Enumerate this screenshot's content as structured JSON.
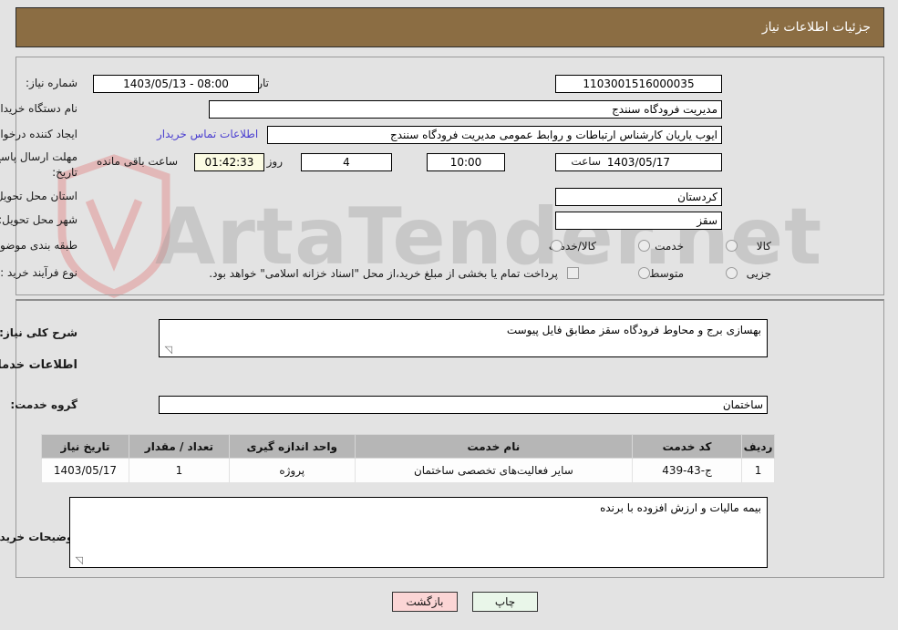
{
  "header": {
    "title": "جزئیات اطلاعات نیاز",
    "bar_color": "#8b6d43"
  },
  "watermark": {
    "text": "ArtaTender.net"
  },
  "top_form": {
    "need_number_label": "شماره نیاز:",
    "need_number_value": "1103001516000035",
    "announce_datetime_label": "تاریخ و ساعت اعلان عمومی:",
    "announce_datetime_value": "08:00 - 1403/05/13",
    "buyer_org_label": "نام دستگاه خریدار:",
    "buyer_org_value": "مدیریت فرودگاه سنندج",
    "creator_label": "ایجاد کننده درخواست:",
    "creator_value": "ایوب یاریان کارشناس ارتباطات و روابط عمومی مدیریت فرودگاه سنندج",
    "contact_link": "اطلاعات تماس خریدار",
    "deadline_label_line1": "مهلت ارسال پاسخ: تا",
    "deadline_label_line2": "تاریخ:",
    "deadline_date": "1403/05/17",
    "deadline_hour_label": "ساعت",
    "deadline_hour_value": "10:00",
    "remaining_days": "4",
    "remaining_days_label": "روز و",
    "remaining_time": "01:42:33",
    "remaining_time_label": "ساعت باقی مانده",
    "province_label": "استان محل تحویل:",
    "province_value": "کردستان",
    "city_label": "شهر محل تحویل:",
    "city_value": "سقز",
    "category_label": "طبقه بندی موضوعی:",
    "category_options": [
      {
        "label": "کالا",
        "selected": false
      },
      {
        "label": "خدمت",
        "selected": false
      },
      {
        "label": "کالا/خدمت",
        "selected": false
      }
    ],
    "process_label": "نوع فرآیند خرید :",
    "process_options": [
      {
        "label": "جزیی",
        "selected": false
      },
      {
        "label": "متوسط",
        "selected": false
      }
    ],
    "treasury_checkbox_label": "پرداخت تمام یا بخشی از مبلغ خرید،از محل \"اسناد خزانه اسلامی\" خواهد بود.",
    "treasury_checked": false
  },
  "mid_form": {
    "summary_label": "شرح کلی نیاز:",
    "summary_value": "بهسازی برج و محاوط فرودگاه سقز مطابق فایل پیوست",
    "services_heading": "اطلاعات خدمات مورد نیاز",
    "service_group_label": "گروه خدمت:",
    "service_group_value": "ساختمان",
    "buyer_notes_label": "توضیحات خریدار:",
    "buyer_notes_value": "بیمه مالیات و ارزش افزوده با  برنده"
  },
  "table": {
    "columns": [
      "ردیف",
      "کد خدمت",
      "نام خدمت",
      "واحد اندازه گیری",
      "تعداد / مقدار",
      "تاریخ نیاز"
    ],
    "rows": [
      {
        "row_no": "1",
        "service_code": "ج-43-439",
        "service_name": "سایر فعالیت‌های تخصصی ساختمان",
        "unit": "پروژه",
        "quantity": "1",
        "need_date": "1403/05/17"
      }
    ]
  },
  "footer": {
    "print_label": "چاپ",
    "back_label": "بازگشت"
  }
}
